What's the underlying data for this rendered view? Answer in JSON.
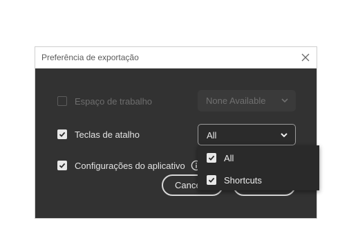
{
  "dialog": {
    "title": "Preferência de exportação"
  },
  "rows": [
    {
      "label": "Espaço de trabalho",
      "checked": false,
      "disabled": true
    },
    {
      "label": "Teclas de atalho",
      "checked": true,
      "disabled": false
    },
    {
      "label": "Configurações do aplicativo",
      "checked": true,
      "disabled": false
    }
  ],
  "workspace_select": {
    "value": "None Available",
    "disabled": true
  },
  "shortcuts_select": {
    "value": "All",
    "expanded": true
  },
  "dropdown": {
    "options": [
      {
        "label": "All",
        "checked": true
      },
      {
        "label": "Shortcuts",
        "checked": true
      }
    ]
  },
  "buttons": {
    "cancel_label": "Cance",
    "export_label": ""
  },
  "icons": {
    "close": "close-icon",
    "info": "info-icon",
    "chevron": "chevron-down-icon",
    "check": "checkmark-icon"
  },
  "colors": {
    "dialog_bg": "#323232",
    "titlebar_bg": "#ffffff",
    "dropdown_bg": "#2a2a2a",
    "text": "#e4e4e4",
    "disabled_text": "#6e6e6e"
  }
}
